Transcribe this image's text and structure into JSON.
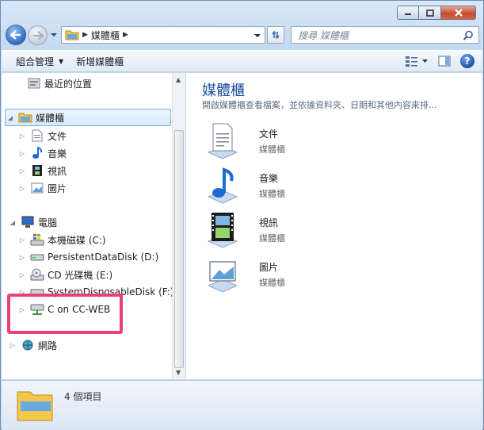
{
  "address": {
    "crumbs": [
      "媒體櫃"
    ]
  },
  "search": {
    "placeholder": "搜尋 媒體櫃"
  },
  "toolbar": {
    "organize": "組合管理",
    "new_library": "新增媒體櫃"
  },
  "nav": {
    "recent": "最近的位置",
    "libraries": "媒體櫃",
    "lib_children": [
      "文件",
      "音樂",
      "視訊",
      "圖片"
    ],
    "computer": "電腦",
    "drives": [
      "本機磁碟 (C:)",
      "PersistentDataDisk (D:)",
      "CD 光碟機 (E:)",
      "SystemDisposableDisk (F:)",
      "C on CC-WEB"
    ],
    "network": "網路"
  },
  "content": {
    "title": "媒體櫃",
    "subtitle": "開啟媒體櫃查看檔案，並依據資料夾、日期和其他內容來排...",
    "items": [
      {
        "name": "文件",
        "type": "媒體櫃",
        "icon": "documents-library-icon"
      },
      {
        "name": "音樂",
        "type": "媒體櫃",
        "icon": "music-library-icon"
      },
      {
        "name": "視訊",
        "type": "媒體櫃",
        "icon": "videos-library-icon"
      },
      {
        "name": "圖片",
        "type": "媒體櫃",
        "icon": "pictures-library-icon"
      }
    ]
  },
  "status": {
    "count": "4 個項目"
  },
  "colors": {
    "highlight": "#ef3f7a",
    "title_blue": "#1b4f9c"
  }
}
